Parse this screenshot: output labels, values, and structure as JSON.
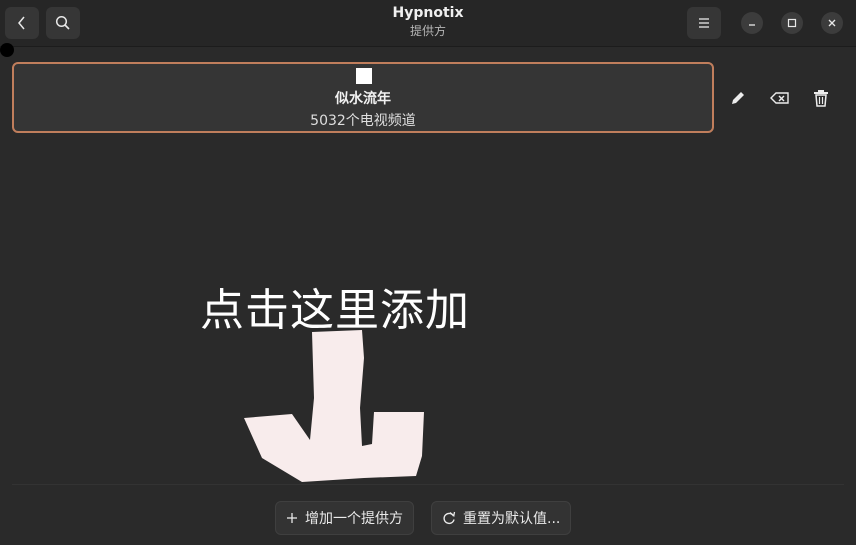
{
  "window": {
    "title": "Hypnotix",
    "subtitle": "提供方"
  },
  "headerbar": {
    "back_icon": "chevron-left-icon",
    "search_icon": "search-icon",
    "menu_icon": "hamburger-menu-icon",
    "minimize_icon": "minimize-icon",
    "maximize_icon": "maximize-icon",
    "close_icon": "close-icon"
  },
  "provider": {
    "name": "似水流年",
    "channel_count": "5032个电视频道"
  },
  "provider_actions": {
    "edit_icon": "pencil-icon",
    "clear_icon": "backspace-icon",
    "delete_icon": "trash-icon"
  },
  "overlay": {
    "hint_text": "点击这里添加"
  },
  "footer": {
    "add_provider_label": "增加一个提供方",
    "reset_label": "重置为默认值..."
  },
  "colors": {
    "background": "#2a2a2a",
    "card": "#353535",
    "accent_border": "#c07e5c",
    "arrow": "#f8ecec"
  }
}
